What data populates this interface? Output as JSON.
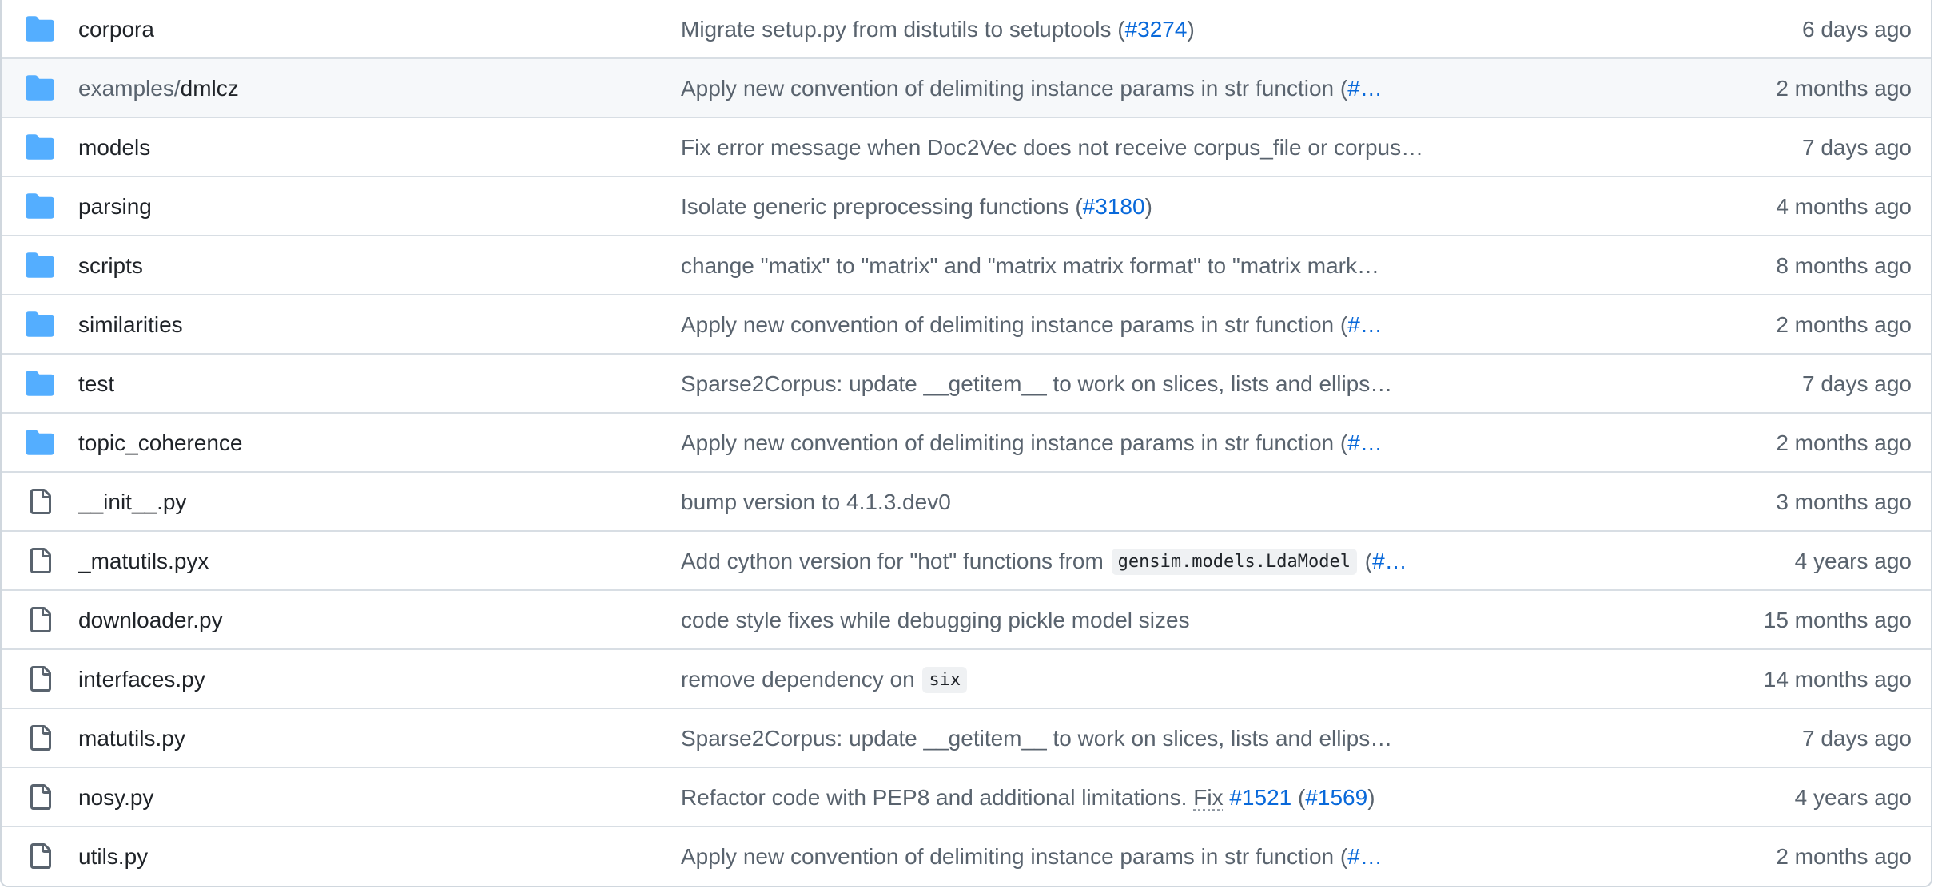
{
  "colors": {
    "folder_icon": "#54aeff",
    "file_icon": "#59636e",
    "link": "#0969da",
    "muted_text": "#59636e",
    "row_border": "#d8dee4",
    "hover_row": "#f6f8fa"
  },
  "rows": [
    {
      "type": "folder",
      "icon": "folder-icon",
      "name": "corpora",
      "message_parts": [
        "Migrate setup.py from distutils to setuptools (",
        "#3274",
        ")"
      ],
      "age": "6 days ago"
    },
    {
      "type": "folder",
      "icon": "folder-icon",
      "name_prefix": "examples/",
      "name": "dmlcz",
      "message_parts": [
        "Apply new convention of delimiting instance params in str function (",
        "#…"
      ],
      "age": "2 months ago"
    },
    {
      "type": "folder",
      "icon": "folder-icon",
      "name": "models",
      "message_parts": [
        "Fix error message when Doc2Vec does not receive corpus_file or corpus…"
      ],
      "age": "7 days ago"
    },
    {
      "type": "folder",
      "icon": "folder-icon",
      "name": "parsing",
      "message_parts": [
        "Isolate generic preprocessing functions (",
        "#3180",
        ")"
      ],
      "age": "4 months ago"
    },
    {
      "type": "folder",
      "icon": "folder-icon",
      "name": "scripts",
      "message_parts": [
        "change \"matix\" to \"matrix\" and \"matrix matrix format\" to \"matrix mark…"
      ],
      "age": "8 months ago"
    },
    {
      "type": "folder",
      "icon": "folder-icon",
      "name": "similarities",
      "message_parts": [
        "Apply new convention of delimiting instance params in str function (",
        "#…"
      ],
      "age": "2 months ago"
    },
    {
      "type": "folder",
      "icon": "folder-icon",
      "name": "test",
      "message_parts": [
        "Sparse2Corpus: update __getitem__ to work on slices, lists and ellips…"
      ],
      "age": "7 days ago"
    },
    {
      "type": "folder",
      "icon": "folder-icon",
      "name": "topic_coherence",
      "message_parts": [
        "Apply new convention of delimiting instance params in str function (",
        "#…"
      ],
      "age": "2 months ago"
    },
    {
      "type": "file",
      "icon": "file-icon",
      "name": "__init__.py",
      "message_parts": [
        "bump version to 4.1.3.dev0"
      ],
      "age": "3 months ago"
    },
    {
      "type": "file",
      "icon": "file-icon",
      "name": "_matutils.pyx",
      "message_parts": [
        "Add cython version for \"hot\" functions from ",
        "gensim.models.LdaModel",
        " (",
        "#…"
      ],
      "age": "4 years ago"
    },
    {
      "type": "file",
      "icon": "file-icon",
      "name": "downloader.py",
      "message_parts": [
        "code style fixes while debugging pickle model sizes"
      ],
      "age": "15 months ago"
    },
    {
      "type": "file",
      "icon": "file-icon",
      "name": "interfaces.py",
      "message_parts": [
        "remove dependency on ",
        "six"
      ],
      "age": "14 months ago"
    },
    {
      "type": "file",
      "icon": "file-icon",
      "name": "matutils.py",
      "message_parts": [
        "Sparse2Corpus: update __getitem__ to work on slices, lists and ellips…"
      ],
      "age": "7 days ago"
    },
    {
      "type": "file",
      "icon": "file-icon",
      "name": "nosy.py",
      "message_parts": [
        "Refactor code with PEP8 and additional limitations. ",
        "Fix",
        " ",
        "#1521",
        " (",
        "#1569",
        ")"
      ],
      "age": "4 years ago"
    },
    {
      "type": "file",
      "icon": "file-icon",
      "name": "utils.py",
      "message_parts": [
        "Apply new convention of delimiting instance params in str function (",
        "#…"
      ],
      "age": "2 months ago"
    }
  ]
}
